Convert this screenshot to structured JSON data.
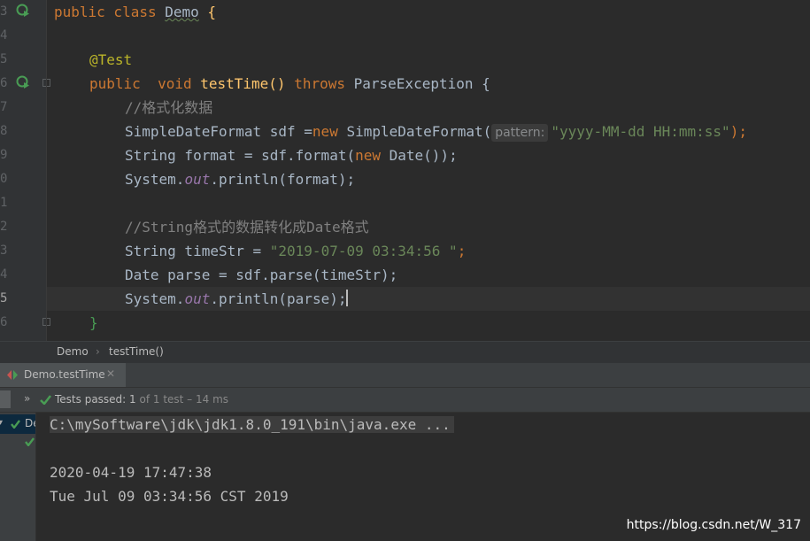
{
  "editor": {
    "line_numbers": [
      "3",
      "4",
      "5",
      "6",
      "7",
      "8",
      "9",
      "0",
      "1",
      "2",
      "3",
      "4",
      "5",
      "6"
    ],
    "lines": {
      "l3": {
        "kw": "public class ",
        "cls": "Demo",
        "tail": " {"
      },
      "l5": {
        "ann": "@Test"
      },
      "l6": {
        "kw1": "public",
        "kw2": "  void ",
        "fn": "testTime",
        "paren": "() ",
        "kw3": "throws",
        "rest": " ParseException {"
      },
      "l7": {
        "cmt": "//格式化数据"
      },
      "l8": {
        "a": "SimpleDateFormat sdf =",
        "kw": "new",
        "b": " SimpleDateFormat(",
        "hint": "pattern:",
        "str": "\"yyyy-MM-dd HH:mm:ss\"",
        "c": ");"
      },
      "l9": {
        "a": "String format = sdf.format(",
        "kw": "new",
        "b": " Date());"
      },
      "l10": {
        "a": "System.",
        "fld": "out",
        "b": ".println(format);"
      },
      "l12": {
        "cmt": "//String格式的数据转化成Date格式"
      },
      "l13": {
        "a": "String timeStr = ",
        "str": "\"2019-07-09 03:34:56 \"",
        "b": ";"
      },
      "l14": {
        "a": "Date parse = sdf.parse(timeStr);"
      },
      "l15": {
        "a": "System.",
        "fld": "out",
        "b": ".println(parse);"
      },
      "l16": {
        "a": "}"
      }
    }
  },
  "breadcrumb": {
    "items": [
      "Demo",
      "testTime()"
    ]
  },
  "run": {
    "tab_label": "Demo.testTime",
    "status_prefix": "Tests passed: ",
    "passed": "1",
    "status_rest": " of 1 test – 14 ms",
    "tree_item": "De"
  },
  "console": {
    "lines": [
      "C:\\mySoftware\\jdk\\jdk1.8.0_191\\bin\\java.exe ...",
      "2020-04-19 17:47:38",
      "Tue Jul 09 03:34:56 CST 2019"
    ]
  },
  "watermark": "https://blog.csdn.net/W_317",
  "colors": {
    "keyword": "#cc7832",
    "string": "#6a8759",
    "comment": "#808080",
    "function": "#ffc66d",
    "annotation": "#bbb529",
    "pass": "#499c54"
  }
}
